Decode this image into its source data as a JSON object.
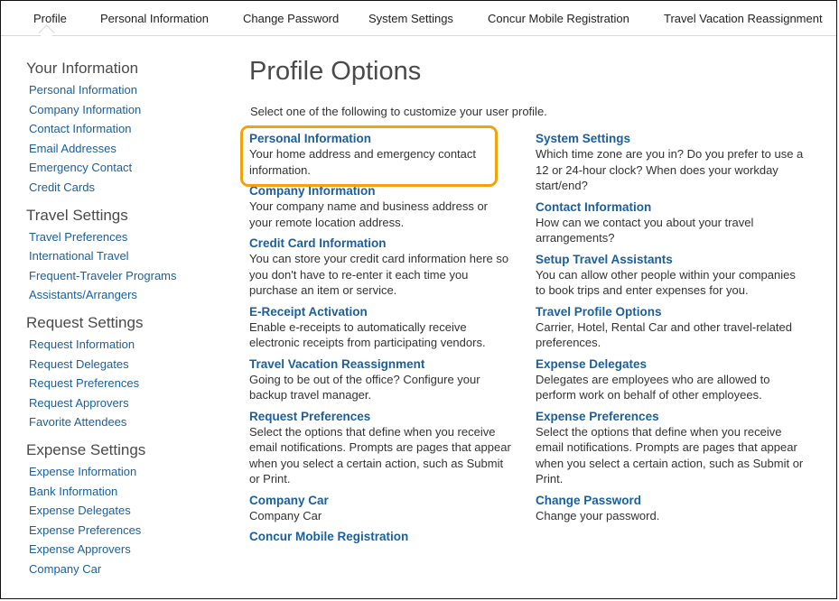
{
  "tabs": [
    "Profile",
    "Personal Information",
    "Change Password",
    "System Settings",
    "Concur Mobile Registration",
    "Travel Vacation Reassignment"
  ],
  "sidebar": {
    "groups": [
      {
        "heading": "Your Information",
        "links": [
          "Personal Information",
          "Company Information",
          "Contact Information",
          "Email Addresses",
          "Emergency Contact",
          "Credit Cards"
        ]
      },
      {
        "heading": "Travel Settings",
        "links": [
          "Travel Preferences",
          "International Travel",
          "Frequent-Traveler Programs",
          "Assistants/Arrangers"
        ]
      },
      {
        "heading": "Request Settings",
        "links": [
          "Request Information",
          "Request Delegates",
          "Request Preferences",
          "Request Approvers",
          "Favorite Attendees"
        ]
      },
      {
        "heading": "Expense Settings",
        "links": [
          "Expense Information",
          "Bank Information",
          "Expense Delegates",
          "Expense Preferences",
          "Expense Approvers",
          "Company Car"
        ]
      }
    ]
  },
  "main": {
    "title": "Profile Options",
    "intro": "Select one of the following to customize your user profile.",
    "left_items": [
      {
        "title": "Personal Information",
        "desc": "Your home address and emergency contact information."
      },
      {
        "title": "Company Information",
        "desc": "Your company name and business address or your remote location address."
      },
      {
        "title": "Credit Card Information",
        "desc": "You can store your credit card information here so you don't have to re-enter it each time you purchase an item or service."
      },
      {
        "title": "E-Receipt Activation",
        "desc": "Enable e-receipts to automatically receive electronic receipts from participating vendors."
      },
      {
        "title": "Travel Vacation Reassignment",
        "desc": "Going to be out of the office? Configure your backup travel manager."
      },
      {
        "title": "Request Preferences",
        "desc": "Select the options that define when you receive email notifications. Prompts are pages that appear when you select a certain action, such as Submit or Print."
      },
      {
        "title": "Company Car",
        "desc": "Company Car"
      },
      {
        "title": "Concur Mobile Registration",
        "desc": ""
      }
    ],
    "right_items": [
      {
        "title": "System Settings",
        "desc": "Which time zone are you in? Do you prefer to use a 12 or 24-hour clock? When does your workday start/end?"
      },
      {
        "title": "Contact Information",
        "desc": "How can we contact you about your travel arrangements?"
      },
      {
        "title": "Setup Travel Assistants",
        "desc": "You can allow other people within your companies to book trips and enter expenses for you."
      },
      {
        "title": "Travel Profile Options",
        "desc": "Carrier, Hotel, Rental Car and other travel-related preferences."
      },
      {
        "title": "Expense Delegates",
        "desc": "Delegates are employees who are allowed to perform work on behalf of other employees."
      },
      {
        "title": "Expense Preferences",
        "desc": "Select the options that define when you receive email notifications. Prompts are pages that appear when you select a certain action, such as Submit or Print."
      },
      {
        "title": "Change Password",
        "desc": "Change your password."
      }
    ]
  },
  "colors": {
    "link": "#1a5f9e",
    "highlight": "#f0a30a"
  }
}
